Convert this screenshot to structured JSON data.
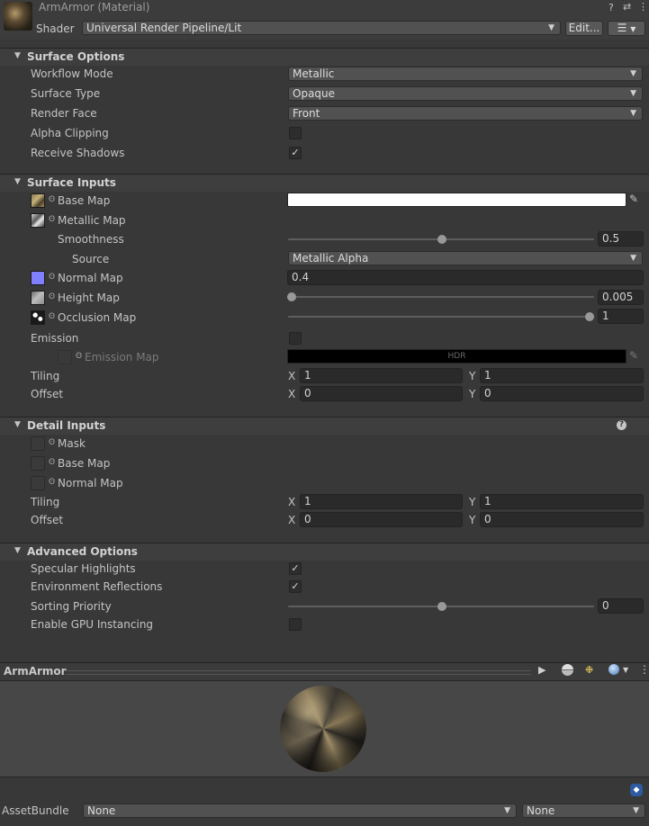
{
  "header": {
    "title": "ArmArmor (Material)",
    "shader_label": "Shader",
    "shader_value": "Universal Render Pipeline/Lit",
    "edit_label": "Edit...",
    "icons": [
      "help-icon",
      "settings-icon",
      "more-icon",
      "list-icon"
    ]
  },
  "surface_options": {
    "title": "Surface Options",
    "workflow_mode": {
      "label": "Workflow Mode",
      "value": "Metallic"
    },
    "surface_type": {
      "label": "Surface Type",
      "value": "Opaque"
    },
    "render_face": {
      "label": "Render Face",
      "value": "Front"
    },
    "alpha_clipping": {
      "label": "Alpha Clipping",
      "checked": false
    },
    "receive_shadows": {
      "label": "Receive Shadows",
      "checked": true,
      "check": "✓"
    }
  },
  "surface_inputs": {
    "title": "Surface Inputs",
    "base_map": {
      "label": "Base Map",
      "color": "#ffffff"
    },
    "metallic_map": {
      "label": "Metallic Map"
    },
    "smoothness": {
      "label": "Smoothness",
      "value": "0.5",
      "fraction": 0.5
    },
    "source": {
      "label": "Source",
      "value": "Metallic Alpha"
    },
    "normal_map": {
      "label": "Normal Map",
      "value": "0.4"
    },
    "height_map": {
      "label": "Height Map",
      "value": "0.005",
      "fraction": 0.0
    },
    "occlusion_map": {
      "label": "Occlusion Map",
      "value": "1",
      "fraction": 1.0
    },
    "emission": {
      "label": "Emission",
      "checked": false
    },
    "emission_map": {
      "label": "Emission Map",
      "hdr": "HDR"
    },
    "tiling": {
      "label": "Tiling",
      "x_label": "X",
      "x": "1",
      "y_label": "Y",
      "y": "1"
    },
    "offset": {
      "label": "Offset",
      "x_label": "X",
      "x": "0",
      "y_label": "Y",
      "y": "0"
    }
  },
  "detail_inputs": {
    "title": "Detail Inputs",
    "mask": {
      "label": "Mask"
    },
    "base_map": {
      "label": "Base Map"
    },
    "normal_map": {
      "label": "Normal Map"
    },
    "tiling": {
      "label": "Tiling",
      "x_label": "X",
      "x": "1",
      "y_label": "Y",
      "y": "1"
    },
    "offset": {
      "label": "Offset",
      "x_label": "X",
      "x": "0",
      "y_label": "Y",
      "y": "0"
    }
  },
  "advanced_options": {
    "title": "Advanced Options",
    "specular_highlights": {
      "label": "Specular Highlights",
      "checked": true,
      "check": "✓"
    },
    "environment_reflections": {
      "label": "Environment Reflections",
      "checked": true,
      "check": "✓"
    },
    "sorting_priority": {
      "label": "Sorting Priority",
      "value": "0",
      "fraction": 0.5
    },
    "gpu_instancing": {
      "label": "Enable GPU Instancing",
      "checked": false
    }
  },
  "preview": {
    "title": "ArmArmor",
    "icons": [
      "play-icon",
      "sphere-icon",
      "lights-icon",
      "preview-shape-icon",
      "more-icon"
    ]
  },
  "asset_bundle": {
    "label": "AssetBundle",
    "name_value": "None",
    "variant_value": "None"
  },
  "colors": {
    "background": "#383838",
    "field": "#2a2a2a",
    "dropdown": "#515151"
  }
}
